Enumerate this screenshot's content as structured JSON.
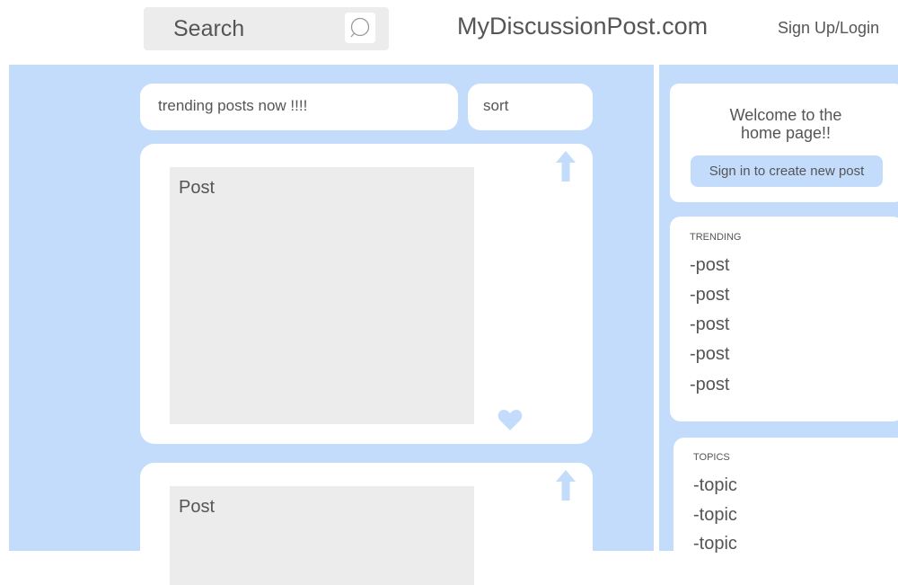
{
  "header": {
    "search_label": "Search",
    "site_title": "MyDiscussionPost.com",
    "signup_label": "Sign Up/Login"
  },
  "feed": {
    "heading": "trending posts now !!!!",
    "sort_label": "sort",
    "posts": [
      {
        "label": "Post"
      },
      {
        "label": "Post"
      }
    ]
  },
  "sidebar": {
    "welcome_line1": "Welcome to the",
    "welcome_line2": "home page!!",
    "signin_label": "Sign in to create new post",
    "trending": {
      "heading": "TRENDING",
      "items": [
        "-post",
        "-post",
        "-post",
        "-post",
        "-post"
      ]
    },
    "topics": {
      "heading": "TOPICS",
      "items": [
        "-topic",
        "-topic",
        "-topic"
      ]
    }
  },
  "colors": {
    "accent": "#c4dcfb",
    "panel_gray": "#ececec",
    "text": "#555555",
    "card": "#ffffff"
  },
  "icons": {
    "search": "search-icon",
    "upvote": "upvote-arrow-icon",
    "like": "heart-icon"
  }
}
